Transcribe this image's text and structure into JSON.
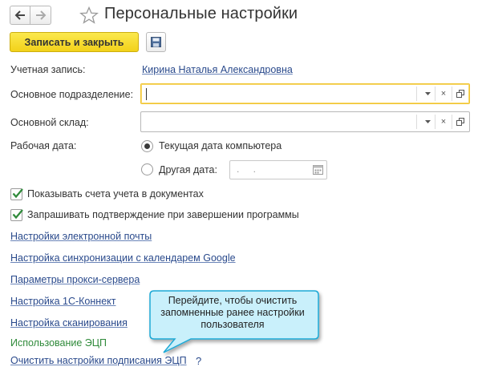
{
  "header": {
    "title": "Персональные настройки"
  },
  "toolbar": {
    "save_close_label": "Записать и закрыть"
  },
  "form": {
    "account_label": "Учетная запись:",
    "account_value": "Кирина Наталья Александровна",
    "department_label": "Основное подразделение:",
    "department_value": "",
    "warehouse_label": "Основной склад:",
    "warehouse_value": "",
    "workdate_label": "Рабочая дата:",
    "radio_current": "Текущая дата компьютера",
    "radio_other": "Другая дата:",
    "date_placeholder": ". .",
    "selected_radio": "current",
    "check_accounts": "Показывать счета учета в документах",
    "check_accounts_checked": true,
    "check_confirm": "Запрашивать подтверждение при завершении программы",
    "check_confirm_checked": true
  },
  "links": {
    "email": "Настройки электронной почты",
    "google_sync": "Настройка синхронизации с календарем Google",
    "proxy": "Параметры прокси-сервера",
    "connect": "Настройка 1С-Коннект",
    "scan": "Настройка сканирования",
    "eds_group": "Использование ЭЦП",
    "clear_eds": "Очистить настройки подписания ЭЦП",
    "help_mark": "?"
  },
  "callout": {
    "text": "Перейдите, чтобы очистить запомненные ранее настройки пользователя"
  },
  "colors": {
    "primary_button": "#f2d21a",
    "link": "#2a4a8c",
    "focus_border": "#f0c430",
    "callout_fill": "#c9f0fb",
    "callout_border": "#1fa9d6",
    "group_title": "#2f8a3a"
  },
  "icons": {
    "back": "arrow-left-icon",
    "forward": "arrow-right-icon",
    "favorite": "star-icon",
    "save": "floppy-disk-icon",
    "dropdown": "chevron-down-icon",
    "clear": "close-icon",
    "open": "open-window-icon",
    "calendar": "calendar-icon",
    "check": "checkmark-icon"
  }
}
